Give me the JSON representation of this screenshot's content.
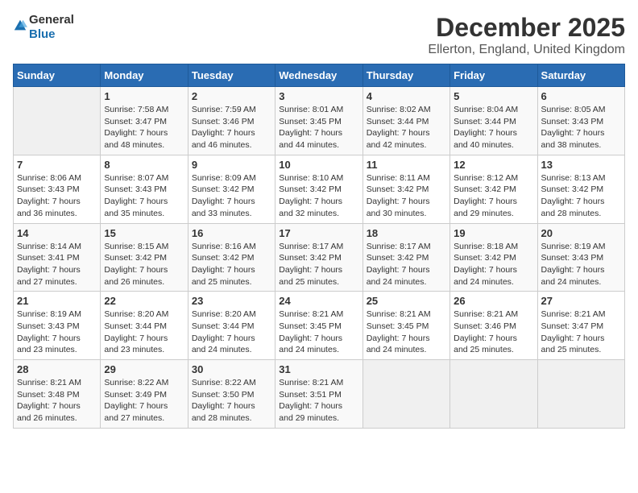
{
  "logo": {
    "text_general": "General",
    "text_blue": "Blue"
  },
  "title": "December 2025",
  "subtitle": "Ellerton, England, United Kingdom",
  "header_days": [
    "Sunday",
    "Monday",
    "Tuesday",
    "Wednesday",
    "Thursday",
    "Friday",
    "Saturday"
  ],
  "weeks": [
    [
      {
        "day": "",
        "info": ""
      },
      {
        "day": "1",
        "info": "Sunrise: 7:58 AM\nSunset: 3:47 PM\nDaylight: 7 hours\nand 48 minutes."
      },
      {
        "day": "2",
        "info": "Sunrise: 7:59 AM\nSunset: 3:46 PM\nDaylight: 7 hours\nand 46 minutes."
      },
      {
        "day": "3",
        "info": "Sunrise: 8:01 AM\nSunset: 3:45 PM\nDaylight: 7 hours\nand 44 minutes."
      },
      {
        "day": "4",
        "info": "Sunrise: 8:02 AM\nSunset: 3:44 PM\nDaylight: 7 hours\nand 42 minutes."
      },
      {
        "day": "5",
        "info": "Sunrise: 8:04 AM\nSunset: 3:44 PM\nDaylight: 7 hours\nand 40 minutes."
      },
      {
        "day": "6",
        "info": "Sunrise: 8:05 AM\nSunset: 3:43 PM\nDaylight: 7 hours\nand 38 minutes."
      }
    ],
    [
      {
        "day": "7",
        "info": "Sunrise: 8:06 AM\nSunset: 3:43 PM\nDaylight: 7 hours\nand 36 minutes."
      },
      {
        "day": "8",
        "info": "Sunrise: 8:07 AM\nSunset: 3:43 PM\nDaylight: 7 hours\nand 35 minutes."
      },
      {
        "day": "9",
        "info": "Sunrise: 8:09 AM\nSunset: 3:42 PM\nDaylight: 7 hours\nand 33 minutes."
      },
      {
        "day": "10",
        "info": "Sunrise: 8:10 AM\nSunset: 3:42 PM\nDaylight: 7 hours\nand 32 minutes."
      },
      {
        "day": "11",
        "info": "Sunrise: 8:11 AM\nSunset: 3:42 PM\nDaylight: 7 hours\nand 30 minutes."
      },
      {
        "day": "12",
        "info": "Sunrise: 8:12 AM\nSunset: 3:42 PM\nDaylight: 7 hours\nand 29 minutes."
      },
      {
        "day": "13",
        "info": "Sunrise: 8:13 AM\nSunset: 3:42 PM\nDaylight: 7 hours\nand 28 minutes."
      }
    ],
    [
      {
        "day": "14",
        "info": "Sunrise: 8:14 AM\nSunset: 3:41 PM\nDaylight: 7 hours\nand 27 minutes."
      },
      {
        "day": "15",
        "info": "Sunrise: 8:15 AM\nSunset: 3:42 PM\nDaylight: 7 hours\nand 26 minutes."
      },
      {
        "day": "16",
        "info": "Sunrise: 8:16 AM\nSunset: 3:42 PM\nDaylight: 7 hours\nand 25 minutes."
      },
      {
        "day": "17",
        "info": "Sunrise: 8:17 AM\nSunset: 3:42 PM\nDaylight: 7 hours\nand 25 minutes."
      },
      {
        "day": "18",
        "info": "Sunrise: 8:17 AM\nSunset: 3:42 PM\nDaylight: 7 hours\nand 24 minutes."
      },
      {
        "day": "19",
        "info": "Sunrise: 8:18 AM\nSunset: 3:42 PM\nDaylight: 7 hours\nand 24 minutes."
      },
      {
        "day": "20",
        "info": "Sunrise: 8:19 AM\nSunset: 3:43 PM\nDaylight: 7 hours\nand 24 minutes."
      }
    ],
    [
      {
        "day": "21",
        "info": "Sunrise: 8:19 AM\nSunset: 3:43 PM\nDaylight: 7 hours\nand 23 minutes."
      },
      {
        "day": "22",
        "info": "Sunrise: 8:20 AM\nSunset: 3:44 PM\nDaylight: 7 hours\nand 23 minutes."
      },
      {
        "day": "23",
        "info": "Sunrise: 8:20 AM\nSunset: 3:44 PM\nDaylight: 7 hours\nand 24 minutes."
      },
      {
        "day": "24",
        "info": "Sunrise: 8:21 AM\nSunset: 3:45 PM\nDaylight: 7 hours\nand 24 minutes."
      },
      {
        "day": "25",
        "info": "Sunrise: 8:21 AM\nSunset: 3:45 PM\nDaylight: 7 hours\nand 24 minutes."
      },
      {
        "day": "26",
        "info": "Sunrise: 8:21 AM\nSunset: 3:46 PM\nDaylight: 7 hours\nand 25 minutes."
      },
      {
        "day": "27",
        "info": "Sunrise: 8:21 AM\nSunset: 3:47 PM\nDaylight: 7 hours\nand 25 minutes."
      }
    ],
    [
      {
        "day": "28",
        "info": "Sunrise: 8:21 AM\nSunset: 3:48 PM\nDaylight: 7 hours\nand 26 minutes."
      },
      {
        "day": "29",
        "info": "Sunrise: 8:22 AM\nSunset: 3:49 PM\nDaylight: 7 hours\nand 27 minutes."
      },
      {
        "day": "30",
        "info": "Sunrise: 8:22 AM\nSunset: 3:50 PM\nDaylight: 7 hours\nand 28 minutes."
      },
      {
        "day": "31",
        "info": "Sunrise: 8:21 AM\nSunset: 3:51 PM\nDaylight: 7 hours\nand 29 minutes."
      },
      {
        "day": "",
        "info": ""
      },
      {
        "day": "",
        "info": ""
      },
      {
        "day": "",
        "info": ""
      }
    ]
  ]
}
